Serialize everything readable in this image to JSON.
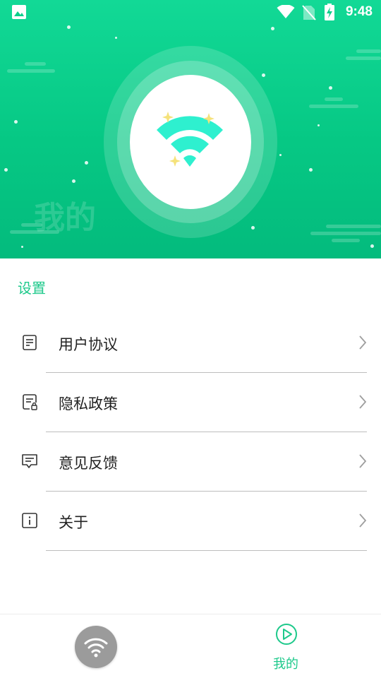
{
  "status_bar": {
    "time": "9:48",
    "icons": [
      "image-icon",
      "wifi-signal-icon",
      "no-sim-icon",
      "battery-charging-icon"
    ]
  },
  "hero": {
    "watermark": "我的",
    "icon": "wifi-icon"
  },
  "settings": {
    "title": "设置",
    "items": [
      {
        "label": "用户协议",
        "icon": "document-icon"
      },
      {
        "label": "隐私政策",
        "icon": "privacy-document-icon"
      },
      {
        "label": "意见反馈",
        "icon": "feedback-icon"
      },
      {
        "label": "关于",
        "icon": "info-icon"
      }
    ]
  },
  "bottom_nav": {
    "wifi_tab": {
      "icon": "wifi-icon"
    },
    "mine_tab": {
      "label": "我的",
      "icon": "play-circle-icon"
    }
  },
  "colors": {
    "accent": "#1ec98b",
    "hero_green": "#06c884",
    "wifi_cyan": "#2ef0cf",
    "sparkle": "#f5e27a",
    "nav_grey": "#9b9b9b"
  }
}
